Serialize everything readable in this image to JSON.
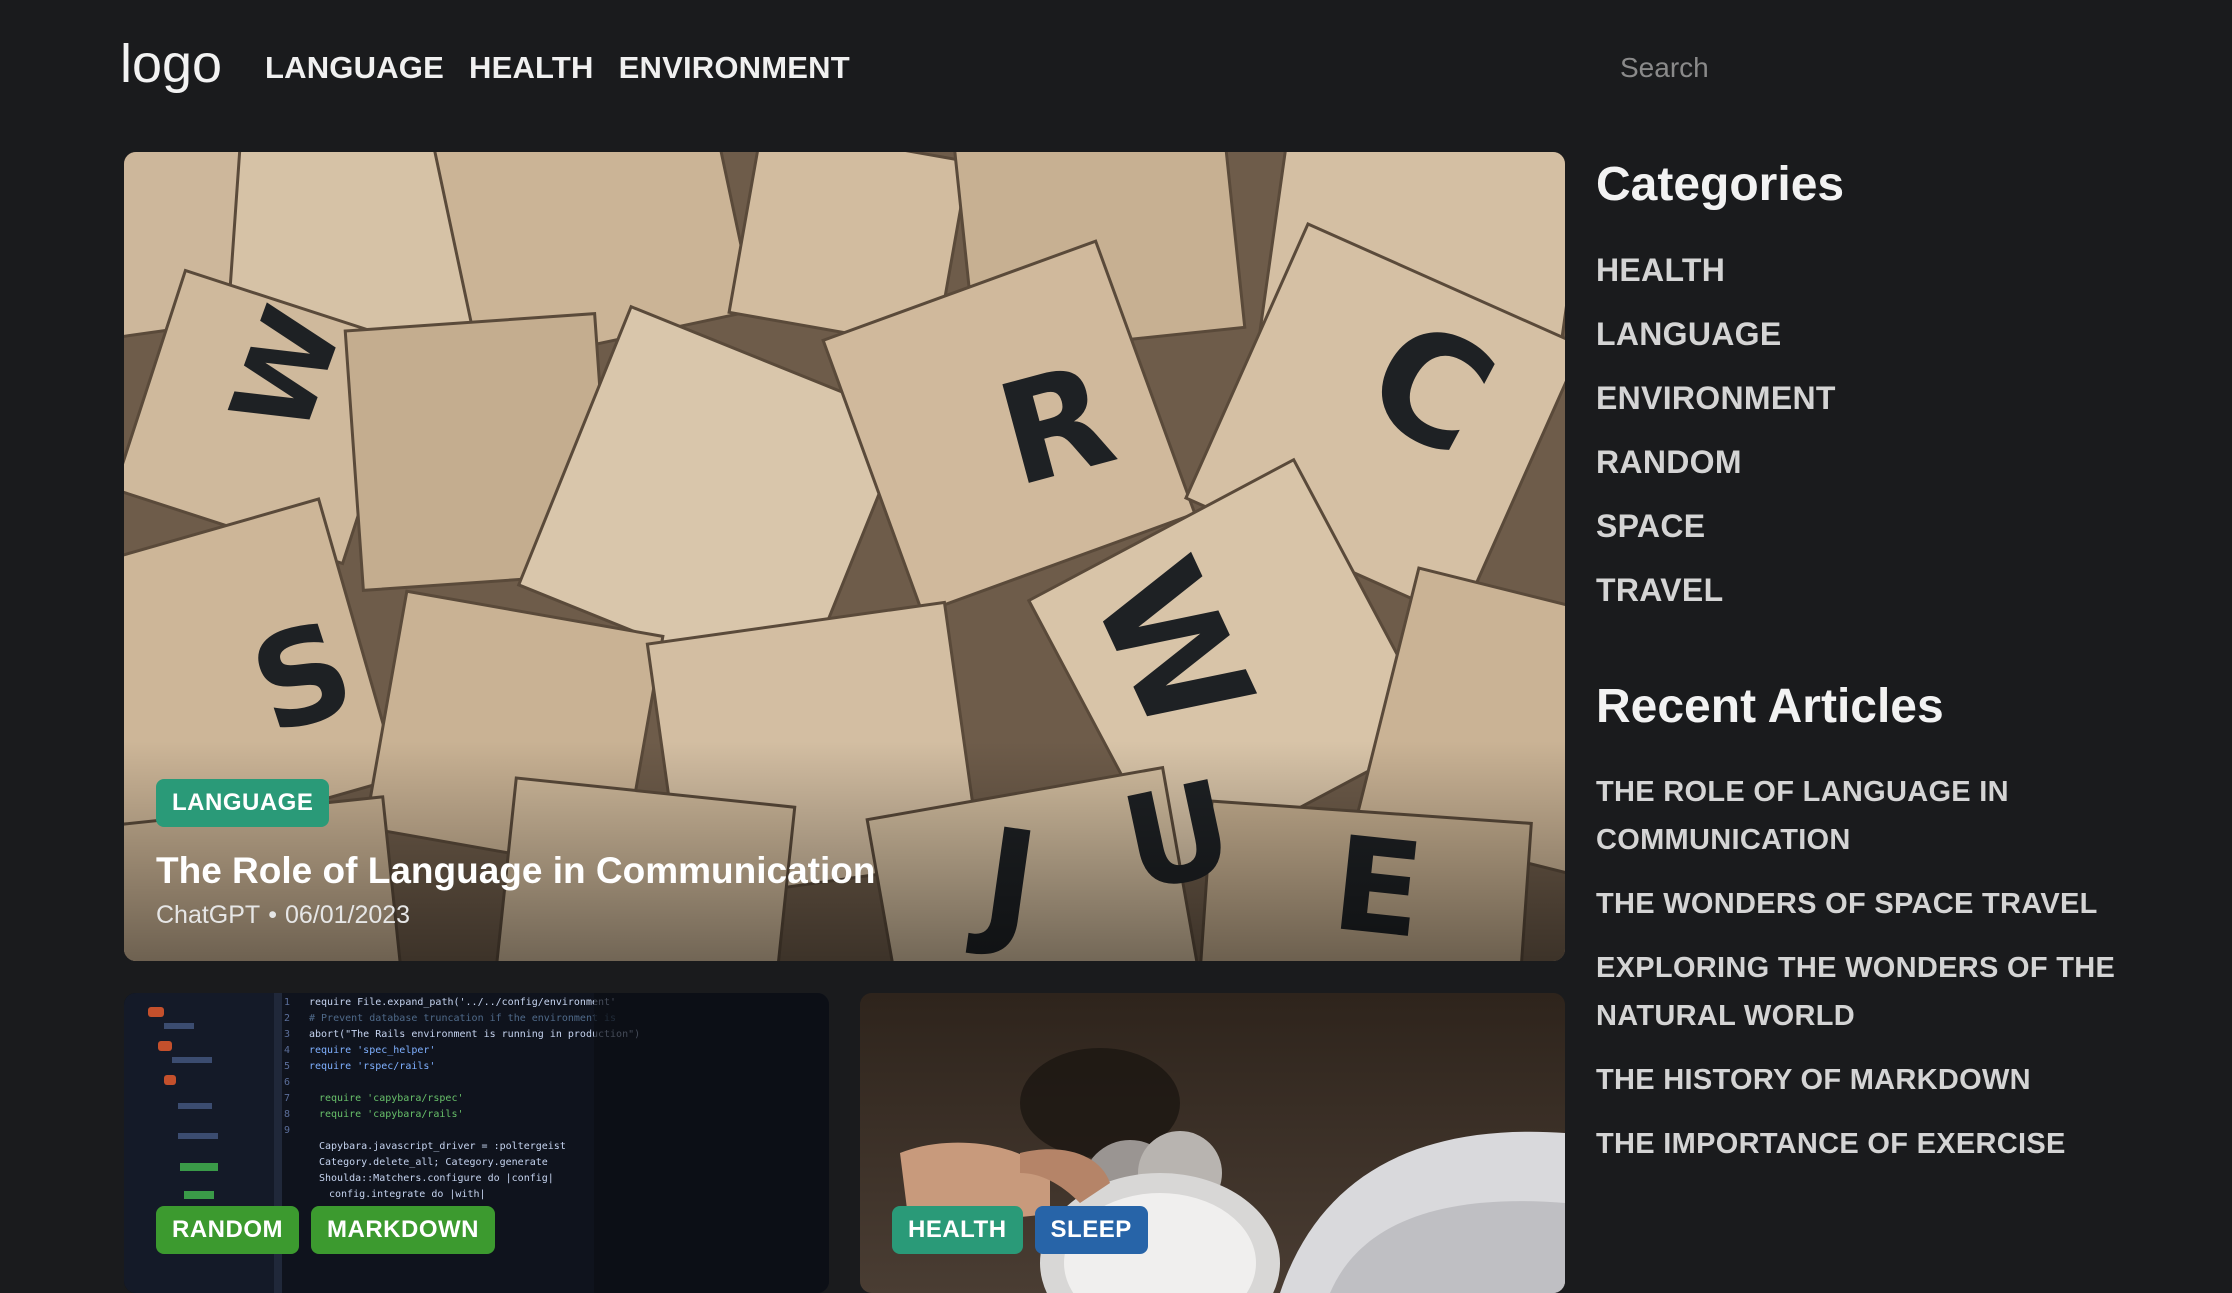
{
  "header": {
    "logo": "logo",
    "nav": [
      "LANGUAGE",
      "HEALTH",
      "ENVIRONMENT"
    ],
    "search_placeholder": "Search"
  },
  "hero": {
    "tags": [
      "LANGUAGE"
    ],
    "title": "The Role of Language in Communication",
    "author": "ChatGPT",
    "separator": "•",
    "date": "06/01/2023"
  },
  "cards": [
    {
      "tags": [
        "RANDOM",
        "MARKDOWN"
      ]
    },
    {
      "tags": [
        "HEALTH",
        "SLEEP"
      ]
    }
  ],
  "sidebar": {
    "categories_heading": "Categories",
    "categories": [
      "HEALTH",
      "LANGUAGE",
      "ENVIRONMENT",
      "RANDOM",
      "SPACE",
      "TRAVEL"
    ],
    "recent_heading": "Recent Articles",
    "recent": [
      "THE ROLE OF LANGUAGE IN COMMUNICATION",
      "THE WONDERS OF SPACE TRAVEL",
      "EXPLORING THE WONDERS OF THE NATURAL WORLD",
      "THE HISTORY OF MARKDOWN",
      "THE IMPORTANCE OF EXERCISE"
    ]
  },
  "colors": {
    "background": "#1a1b1d",
    "tag_teal": "#2a9a78",
    "tag_green": "#3c9a2f",
    "tag_blue": "#2764a8"
  },
  "icons": {
    "hero_image": "scrabble-tiles-photo",
    "card_left_image": "code-editor-photo",
    "card_right_image": "alarm-clock-photo"
  }
}
